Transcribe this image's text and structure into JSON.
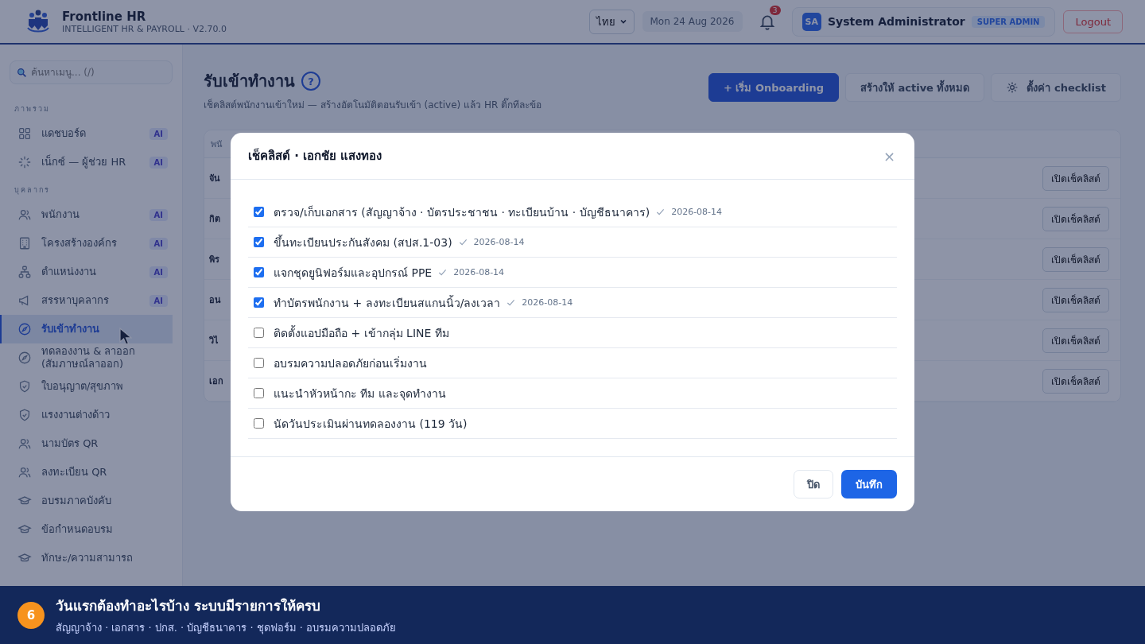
{
  "header": {
    "app_name": "Frontline HR",
    "app_subtitle": "INTELLIGENT HR & PAYROLL · V2.70.0",
    "language": "ไทย",
    "date": "Mon 24 Aug 2026",
    "notification_count": "3",
    "user_initials": "SA",
    "user_name": "System Administrator",
    "user_role": "SUPER ADMIN",
    "logout": "Logout"
  },
  "sidebar": {
    "search_placeholder": "ค้นหาเมนู... (/)",
    "sections": [
      {
        "title": "ภาพรวม",
        "items": [
          {
            "label": "แดชบอร์ด",
            "badge": "AI",
            "selected": false
          },
          {
            "label": "เน็กซ์ — ผู้ช่วย HR",
            "badge": "AI",
            "selected": false
          }
        ]
      },
      {
        "title": "บุคลากร",
        "items": [
          {
            "label": "พนักงาน",
            "badge": "AI",
            "selected": false
          },
          {
            "label": "โครงสร้างองค์กร",
            "badge": "AI",
            "selected": false
          },
          {
            "label": "ตำแหน่งงาน",
            "badge": "AI",
            "selected": false
          },
          {
            "label": "สรรหาบุคลากร",
            "badge": "AI",
            "selected": false
          },
          {
            "label": "รับเข้าทำงาน",
            "selected": true
          },
          {
            "label": "ทดลองงาน & ลาออก (สัมภาษณ์ลาออก)",
            "selected": false
          },
          {
            "label": "ใบอนุญาต/สุขภาพ",
            "selected": false
          },
          {
            "label": "แรงงานต่างด้าว",
            "selected": false
          },
          {
            "label": "นามบัตร QR",
            "selected": false
          },
          {
            "label": "ลงทะเบียน QR",
            "selected": false
          },
          {
            "label": "อบรมภาคบังคับ",
            "selected": false
          },
          {
            "label": "ข้อกำหนดอบรม",
            "selected": false
          },
          {
            "label": "ทักษะ/ความสามารถ",
            "selected": false
          }
        ]
      }
    ]
  },
  "page": {
    "title": "รับเข้าทำงาน",
    "help": "?",
    "subtitle": "เช็คลิสต์พนักงานเข้าใหม่ — สร้างอัตโนมัติตอนรับเข้า (active) แล้ว HR ติ๊กทีละข้อ",
    "buttons": [
      {
        "label": "+ เริ่ม Onboarding",
        "kind": "primary"
      },
      {
        "label": "สร้างให้ active ทั้งหมด",
        "kind": "secondary"
      },
      {
        "label": "ตั้งค่า checklist",
        "kind": "settings"
      }
    ]
  },
  "table": {
    "column_1": "พนั",
    "rows": [
      {
        "column_1": "จัน",
        "action": "เปิดเช็คลิสต์"
      },
      {
        "column_1": "กิต",
        "action": "เปิดเช็คลิสต์"
      },
      {
        "column_1": "พิร",
        "action": "เปิดเช็คลิสต์"
      },
      {
        "column_1": "อน",
        "action": "เปิดเช็คลิสต์"
      },
      {
        "column_1": "วิไ",
        "action": "เปิดเช็คลิสต์"
      },
      {
        "column_1": "เอก",
        "action": "เปิดเช็คลิสต์"
      }
    ]
  },
  "modal": {
    "title": "เช็คลิสต์ · เอกชัย แสงทอง",
    "close": "×",
    "items": [
      {
        "label": "ตรวจ/เก็บเอกสาร (สัญญาจ้าง · บัตรประชาชน · ทะเบียนบ้าน · บัญชีธนาคาร)",
        "checked": true,
        "date": "2026-08-14"
      },
      {
        "label": "ขึ้นทะเบียนประกันสังคม (สปส.1-03)",
        "checked": true,
        "date": "2026-08-14"
      },
      {
        "label": "แจกชุดยูนิฟอร์มและอุปกรณ์ PPE",
        "checked": true,
        "date": "2026-08-14"
      },
      {
        "label": "ทำบัตรพนักงาน + ลงทะเบียนสแกนนิ้ว/ลงเวลา",
        "checked": true,
        "date": "2026-08-14"
      },
      {
        "label": "ติดตั้งแอปมือถือ + เข้ากลุ่ม LINE ทีม",
        "checked": false
      },
      {
        "label": "อบรมความปลอดภัยก่อนเริ่มงาน",
        "checked": false
      },
      {
        "label": "แนะนำหัวหน้ากะ ทีม และจุดทำงาน",
        "checked": false
      },
      {
        "label": "นัดวันประเมินผ่านทดลองงาน (119 วัน)",
        "checked": false
      }
    ],
    "cancel": "ปิด",
    "save": "บันทึก"
  },
  "banner": {
    "step": "6",
    "title": "วันแรกต้องทำอะไรบ้าง ระบบมีรายการให้ครบ",
    "text": "สัญญาจ้าง · เอกสาร · ปกส. · บัญชีธนาคาร · ชุดฟอร์ม · อบรมความปลอดภัย"
  }
}
